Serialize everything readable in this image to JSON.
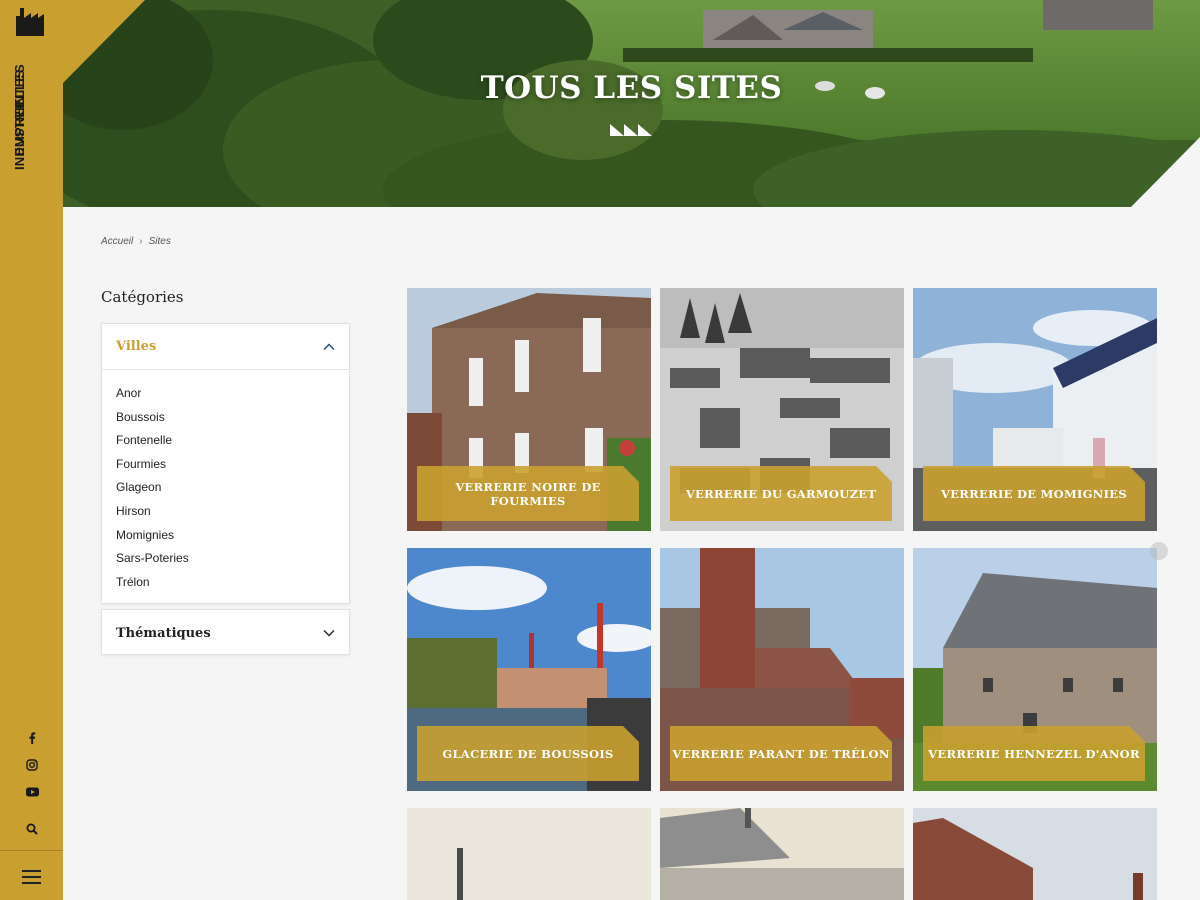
{
  "brand": {
    "line1": "EMPREINTES",
    "line2": "INDUSTRIELLES"
  },
  "sidebar": {
    "icons": [
      "facebook-icon",
      "instagram-icon",
      "youtube-icon",
      "search-icon",
      "menu-icon"
    ]
  },
  "hero": {
    "title": "TOUS LES SITES"
  },
  "breadcrumb": {
    "home": "Accueil",
    "current": "Sites"
  },
  "categories": {
    "title": "Catégories",
    "villes": {
      "label": "Villes",
      "items": [
        "Anor",
        "Boussois",
        "Fontenelle",
        "Fourmies",
        "Glageon",
        "Hirson",
        "Momignies",
        "Sars-Poteries",
        "Trélon"
      ]
    },
    "thematiques": {
      "label": "Thématiques"
    }
  },
  "sites": [
    {
      "title": "VERRERIE NOIRE DE FOURMIES"
    },
    {
      "title": "VERRERIE DU GARMOUZET"
    },
    {
      "title": "VERRERIE DE MOMIGNIES"
    },
    {
      "title": "GLACERIE DE BOUSSOIS"
    },
    {
      "title": "VERRERIE PARANT DE TRÉLON"
    },
    {
      "title": "VERRERIE HENNEZEL D'ANOR"
    }
  ],
  "colors": {
    "accent": "#c9a030",
    "background": "#f5f5f5"
  }
}
